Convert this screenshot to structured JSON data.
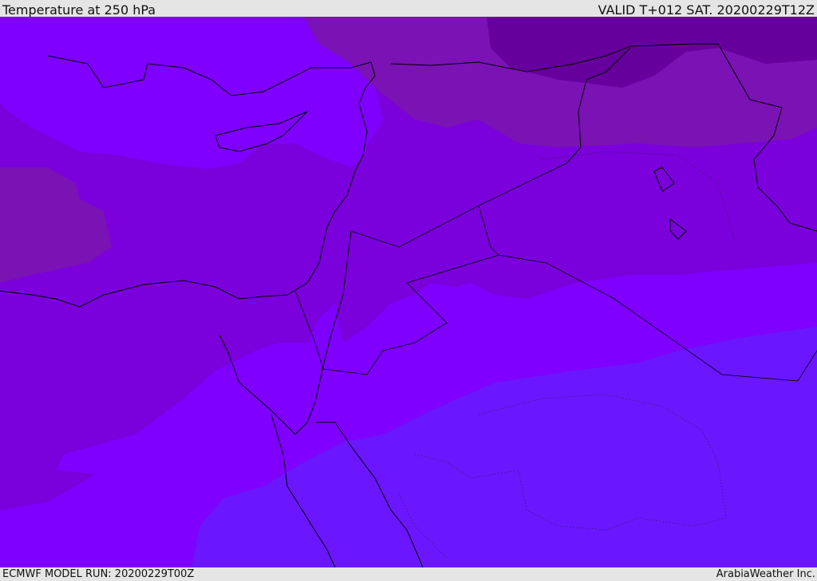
{
  "header": {
    "title": "Temperature at 250 hPa",
    "valid": "VALID T+012 SAT. 20200229T12Z"
  },
  "footer": {
    "model_run": "ECMWF MODEL RUN: 20200229T00Z",
    "credit": "ArabiaWeather Inc."
  },
  "colors": {
    "base": "#7a00dc",
    "light": "#7f00ff",
    "blue": "#6a16ff",
    "muted": "#7a12b4",
    "dark": "#65009c"
  }
}
